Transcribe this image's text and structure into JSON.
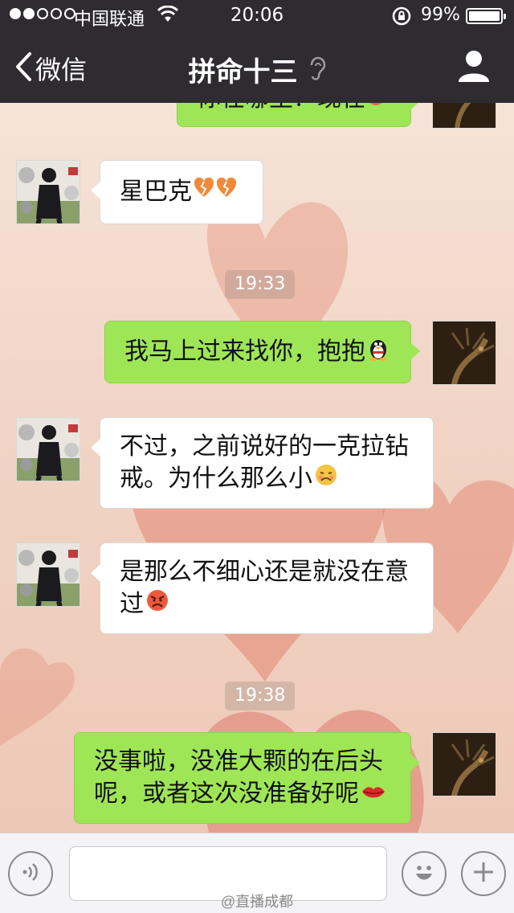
{
  "status_bar": {
    "carrier": "中国联通",
    "time": "20:06",
    "battery_percent": "99%",
    "battery_level": 0.99
  },
  "nav": {
    "back_label": "微信",
    "title": "拼命十三",
    "earpiece_icon": "ear-icon",
    "profile_icon": "person-icon"
  },
  "messages": [
    {
      "side": "right",
      "text": "你在哪里？现在",
      "partial": true
    },
    {
      "side": "left",
      "text": "星巴克",
      "emoji": "broken-heart-emoji x2"
    },
    {
      "timestamp": "19:33"
    },
    {
      "side": "right",
      "text": "我马上过来找你，抱抱",
      "emoji": "qq-penguin-emoji"
    },
    {
      "side": "left",
      "lines": [
        "不过，之前说好的一克拉钻",
        "戒。为什么那么小"
      ],
      "emoji": "pouting-face-emoji"
    },
    {
      "side": "left",
      "lines": [
        "是那么不细心还是就没在意",
        "过"
      ],
      "emoji": "angry-face-emoji"
    },
    {
      "timestamp": "19:38"
    },
    {
      "side": "right",
      "lines": [
        "没事啦，没准大颗的在后头",
        "呢，或者这次没准备好呢"
      ],
      "emoji": "lips-emoji"
    }
  ],
  "input_bar": {
    "voice_icon": "voice-icon",
    "emoji_icon": "smiley-icon",
    "add_icon": "plus-icon",
    "text_value": ""
  },
  "watermark": "@直播成都",
  "colors": {
    "nav_bg": "#2e2c31",
    "right_bubble": "#9fe657",
    "left_bubble": "#ffffff",
    "background": "#f2d8cb"
  }
}
